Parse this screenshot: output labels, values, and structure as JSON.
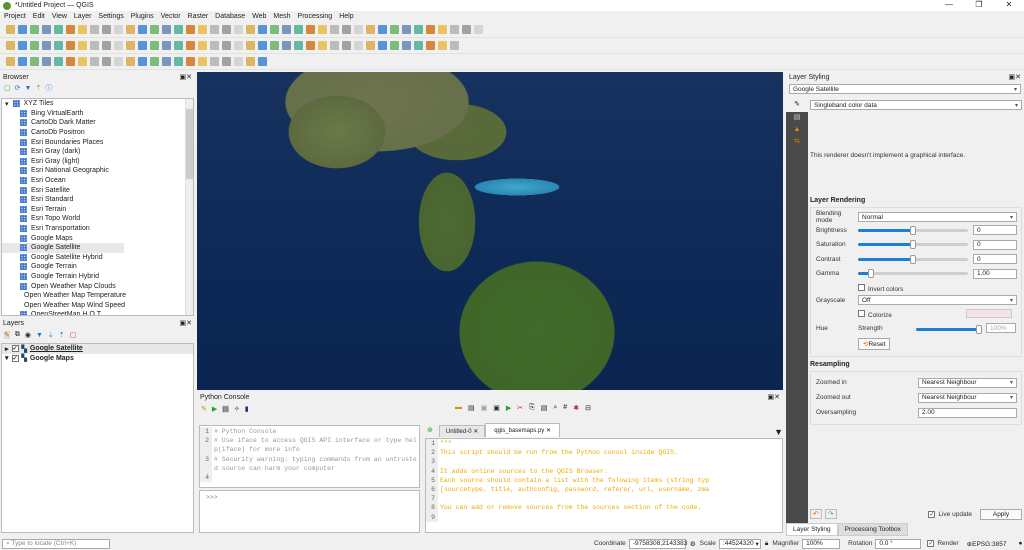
{
  "window": {
    "title": "*Untitled Project — QGIS",
    "controls": [
      "—",
      "❐",
      "✕"
    ]
  },
  "menu": [
    "Project",
    "Edit",
    "View",
    "Layer",
    "Settings",
    "Plugins",
    "Vector",
    "Raster",
    "Database",
    "Web",
    "Mesh",
    "Processing",
    "Help"
  ],
  "browser": {
    "title": "Browser",
    "root": "XYZ Tiles",
    "items": [
      "Bing VirtualEarth",
      "CartoDb Dark Matter",
      "CartoDb Positron",
      "Esri Boundaries Places",
      "Esri Gray (dark)",
      "Esri Gray (light)",
      "Esri National Geographic",
      "Esri Ocean",
      "Esri Satellite",
      "Esri Standard",
      "Esri Terrain",
      "Esri Topo World",
      "Esri Transportation",
      "Google Maps",
      "Google Satellite",
      "Google Satellite Hybrid",
      "Google Terrain",
      "Google Terrain Hybrid",
      "Open Weather Map Clouds",
      "Open Weather Map Temperature",
      "Open Weather Map Wind Speed",
      "OpenStreetMap H.O.T."
    ],
    "selected": "Google Satellite"
  },
  "layers": {
    "title": "Layers",
    "items": [
      {
        "name": "Google Satellite",
        "checked": true
      },
      {
        "name": "Google Maps",
        "checked": true
      }
    ]
  },
  "console": {
    "title": "Python Console",
    "lines": [
      {
        "n": "1",
        "t": "# Python Console"
      },
      {
        "n": "2",
        "t": "# Use iface to access QGIS API interface or type hel"
      },
      {
        "n": "",
        "t": "p(iface) for more info"
      },
      {
        "n": "3",
        "t": "# Security warning: typing commands from an untruste"
      },
      {
        "n": "",
        "t": "d source can harm your computer"
      },
      {
        "n": "4",
        "t": ""
      }
    ],
    "prompt": ">>>",
    "tabs": [
      "Untitled-0",
      "qgis_basemaps.py"
    ],
    "editor": [
      {
        "n": "1",
        "t": "\"\"\""
      },
      {
        "n": "2",
        "t": "This script should be run from the Python consol inside QGIS."
      },
      {
        "n": "3",
        "t": ""
      },
      {
        "n": "4",
        "t": "It adds online sources to the QGIS Browser."
      },
      {
        "n": "5",
        "t": "Each source should contain a list with the folowing items (string typ"
      },
      {
        "n": "6",
        "t": "[sourcetype, title, authconfig, password, referer, url, username, zma"
      },
      {
        "n": "7",
        "t": ""
      },
      {
        "n": "8",
        "t": "You can add or remove sources from the sources section of the code."
      },
      {
        "n": "9",
        "t": ""
      }
    ]
  },
  "styling": {
    "title": "Layer Styling",
    "layer": "Google Satellite",
    "renderer": "Singleband color data",
    "message": "This renderer doesn't implement a graphical interface.",
    "rendering": {
      "title": "Layer Rendering",
      "blending_label": "Blending mode",
      "blending": "Normal",
      "sliders": [
        {
          "label": "Brightness",
          "value": "0",
          "fraction": 0.5
        },
        {
          "label": "Saturation",
          "value": "0",
          "fraction": 0.5
        },
        {
          "label": "Contrast",
          "value": "0",
          "fraction": 0.5
        },
        {
          "label": "Gamma",
          "value": "1.00",
          "fraction": 0.12
        }
      ],
      "invert": "Invert colors",
      "grayscale_label": "Grayscale",
      "grayscale": "Off",
      "hue_label": "Hue",
      "colorize": "Colorize",
      "strength_label": "Strength",
      "strength": "100%",
      "reset": "Reset"
    },
    "resampling": {
      "title": "Resampling",
      "zin_label": "Zoomed in",
      "zin": "Nearest Neighbour",
      "zout_label": "Zoomed out",
      "zout": "Nearest Neighbour",
      "over_label": "Oversampling",
      "over": "2.00"
    },
    "live_update": "Live update",
    "apply": "Apply",
    "tabs": [
      "Layer Styling",
      "Processing Toolbox"
    ]
  },
  "status": {
    "locate_placeholder": "Type to locate (Ctrl+K)",
    "coord_label": "Coordinate",
    "coord": "-9758308,2143383",
    "scale_label": "Scale",
    "scale": ":44524320",
    "magnifier_label": "Magnifier",
    "magnifier": "100%",
    "rotation_label": "Rotation",
    "rotation": "0.0 °",
    "render": "Render",
    "crs": "EPSG:3857"
  }
}
